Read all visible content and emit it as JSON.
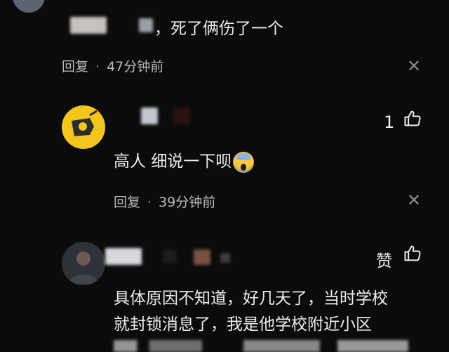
{
  "comments": [
    {
      "text": "，死了俩伤了一个",
      "reply_label": "回复",
      "separator": "·",
      "time": "47分钟前"
    },
    {
      "text": "高人 细说一下呗",
      "emoji": "face-screaming-in-fear",
      "like_count": "1",
      "reply_label": "回复",
      "separator": "·",
      "time": "39分钟前"
    },
    {
      "zan_label": "赞",
      "text_line1": "具体原因不知道，好几天了，当时学校",
      "text_line2": "就封锁消息了，我是他学校附近小区"
    }
  ],
  "icons": {
    "close": "close-icon",
    "like": "thumbs-up-icon"
  }
}
